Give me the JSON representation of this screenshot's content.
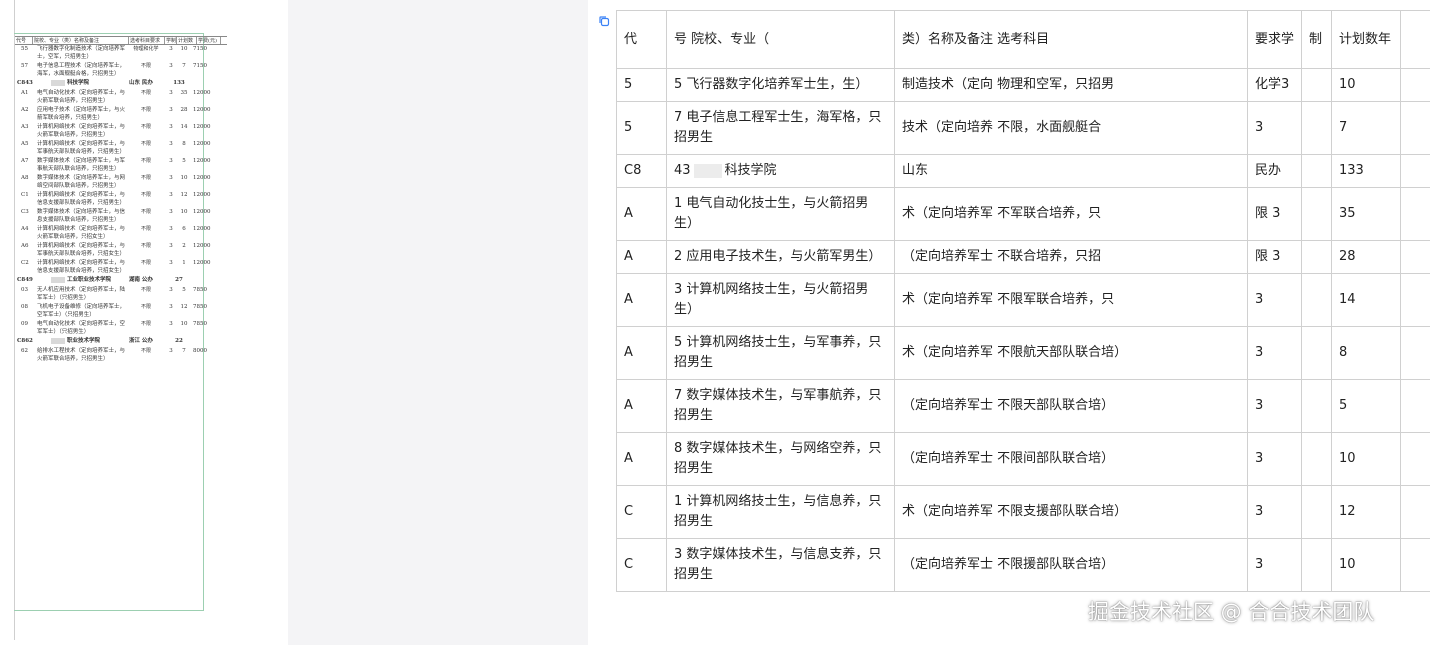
{
  "doc": {
    "header": [
      "代号",
      "院校、专业（类）名称及备注",
      "选考科目要求",
      "学制",
      "计划数",
      "学费(元)"
    ],
    "rows": [
      {
        "type": "major",
        "code": "55",
        "name": "飞行器数字化制造技术（定向培养军士，空军，只招男生）",
        "subject": "物理和化学",
        "years": "3",
        "plan": "10",
        "fee": "7150"
      },
      {
        "type": "major",
        "code": "57",
        "name": "电子信息工程技术（定向培养军士，海军，水面舰艇合格，只招男生）",
        "subject": "不限",
        "years": "3",
        "plan": "7",
        "fee": "7150"
      },
      {
        "type": "school",
        "code": "C843",
        "name": "科技学院",
        "region": "山东  民办",
        "plan": "133"
      },
      {
        "type": "major",
        "code": "A1",
        "name": "电气自动化技术（定向培养军士，与火箭军联合培养，只招男生）",
        "subject": "不限",
        "years": "3",
        "plan": "35",
        "fee": "12000"
      },
      {
        "type": "major",
        "code": "A2",
        "name": "应用电子技术（定向培养军士，与火箭军联合培养，只招男生）",
        "subject": "不限",
        "years": "3",
        "plan": "28",
        "fee": "12000"
      },
      {
        "type": "major",
        "code": "A3",
        "name": "计算机网络技术（定向培养军士，与火箭军联合培养，只招男生）",
        "subject": "不限",
        "years": "3",
        "plan": "14",
        "fee": "12000"
      },
      {
        "type": "major",
        "code": "A5",
        "name": "计算机网络技术（定向培养军士，与军事航天部队联合培养，只招男生）",
        "subject": "不限",
        "years": "3",
        "plan": "8",
        "fee": "12000"
      },
      {
        "type": "major",
        "code": "A7",
        "name": "数字媒体技术（定向培养军士，与军事航天部队联合培养，只招男生）",
        "subject": "不限",
        "years": "3",
        "plan": "5",
        "fee": "12000"
      },
      {
        "type": "major",
        "code": "A8",
        "name": "数字媒体技术（定向培养军士，与网络空间部队联合培养，只招男生）",
        "subject": "不限",
        "years": "3",
        "plan": "10",
        "fee": "12000"
      },
      {
        "type": "major",
        "code": "C1",
        "name": "计算机网络技术（定向培养军士，与信息支援部队联合培养，只招男生）",
        "subject": "不限",
        "years": "3",
        "plan": "12",
        "fee": "12000"
      },
      {
        "type": "major",
        "code": "C3",
        "name": "数字媒体技术（定向培养军士，与信息支援部队联合培养，只招男生）",
        "subject": "不限",
        "years": "3",
        "plan": "10",
        "fee": "12000"
      },
      {
        "type": "major",
        "code": "A4",
        "name": "计算机网络技术（定向培养军士，与火箭军联合培养，只招女生）",
        "subject": "不限",
        "years": "3",
        "plan": "6",
        "fee": "12000"
      },
      {
        "type": "major",
        "code": "A6",
        "name": "计算机网络技术（定向培养军士，与军事航天部队联合培养，只招女生）",
        "subject": "不限",
        "years": "3",
        "plan": "2",
        "fee": "12000"
      },
      {
        "type": "major",
        "code": "C2",
        "name": "计算机网络技术（定向培养军士，与信息支援部队联合培养，只招女生）",
        "subject": "不限",
        "years": "3",
        "plan": "1",
        "fee": "12000"
      },
      {
        "type": "school",
        "code": "C849",
        "name": "工业职业技术学院",
        "region": "湖南  公办",
        "plan": "27"
      },
      {
        "type": "major",
        "code": "03",
        "name": "无人机应用技术（定向培养军士，陆军军士）（只招男生）",
        "subject": "不限",
        "years": "3",
        "plan": "5",
        "fee": "7850"
      },
      {
        "type": "major",
        "code": "08",
        "name": "飞机电子设备维修（定向培养军士，空军军士）（只招男生）",
        "subject": "不限",
        "years": "3",
        "plan": "12",
        "fee": "7850"
      },
      {
        "type": "major",
        "code": "09",
        "name": "电气自动化技术（定向培养军士，空军军士）（只招男生）",
        "subject": "不限",
        "years": "3",
        "plan": "10",
        "fee": "7850"
      },
      {
        "type": "school",
        "code": "C862",
        "name": "职业技术学院",
        "region": "浙江  公办",
        "plan": "22"
      },
      {
        "type": "major",
        "code": "62",
        "name": "给排水工程技术（定向培养军士，与火箭军联合培养，只招男生）",
        "subject": "不限",
        "years": "3",
        "plan": "7",
        "fee": "8000"
      }
    ]
  },
  "grid": {
    "headers": [
      "代",
      "号 院校、专业（",
      "类）名称及备注 选考科目",
      "要求学",
      "制",
      "计划数年",
      ""
    ],
    "rows": [
      [
        "5",
        "5 飞行器数字化培养军士生，生）",
        "制造技术（定向 物理和空军，只招男",
        "化学3",
        "",
        "10",
        ""
      ],
      [
        "5",
        "7 电子信息工程军士生，海军格，只招男生",
        "技术（定向培养 不限，水面舰艇合",
        "3",
        "",
        "7",
        ""
      ],
      [
        "C8",
        "43",
        "山东",
        "民办",
        "",
        "133",
        ""
      ],
      [
        "A",
        "1 电气自动化技士生，与火箭招男生）",
        "术（定向培养军 不军联合培养，只",
        "限 3",
        "",
        "35",
        ""
      ],
      [
        "A",
        "2 应用电子技术生，与火箭军男生）",
        "（定向培养军士 不联合培养，只招",
        "限 3",
        "",
        "28",
        ""
      ],
      [
        "A",
        "3 计算机网络技士生，与火箭招男生）",
        "术（定向培养军 不限军联合培养，只",
        "3",
        "",
        "14",
        ""
      ],
      [
        "A",
        "5 计算机网络技士生，与军事养，只招男生",
        "术（定向培养军 不限航天部队联合培）",
        "3",
        "",
        "8",
        ""
      ],
      [
        "A",
        "7 数字媒体技术生，与军事航养，只招男生",
        "（定向培养军士 不限天部队联合培）",
        "3",
        "",
        "5",
        ""
      ],
      [
        "A",
        "8 数字媒体技术生，与网络空养，只招男生",
        "（定向培养军士 不限间部队联合培）",
        "3",
        "",
        "10",
        ""
      ],
      [
        "C",
        "1 计算机网络技士生，与信息养，只招男生",
        "术（定向培养军 不限支援部队联合培）",
        "3",
        "",
        "12",
        ""
      ],
      [
        "C",
        "3 数字媒体技术生，与信息支养，只招男生",
        "（定向培养军士 不限援部队联合培）",
        "3",
        "",
        "10",
        ""
      ]
    ],
    "school_row_suffix": "科技学院"
  },
  "watermark": "掘金技术社区 @ 合合技术团队",
  "colors": {
    "frame": "#9ccfb1",
    "gutter": "#f4f4f6",
    "grid_border": "#d0d0d0",
    "copy_icon": "#3b82f6"
  }
}
